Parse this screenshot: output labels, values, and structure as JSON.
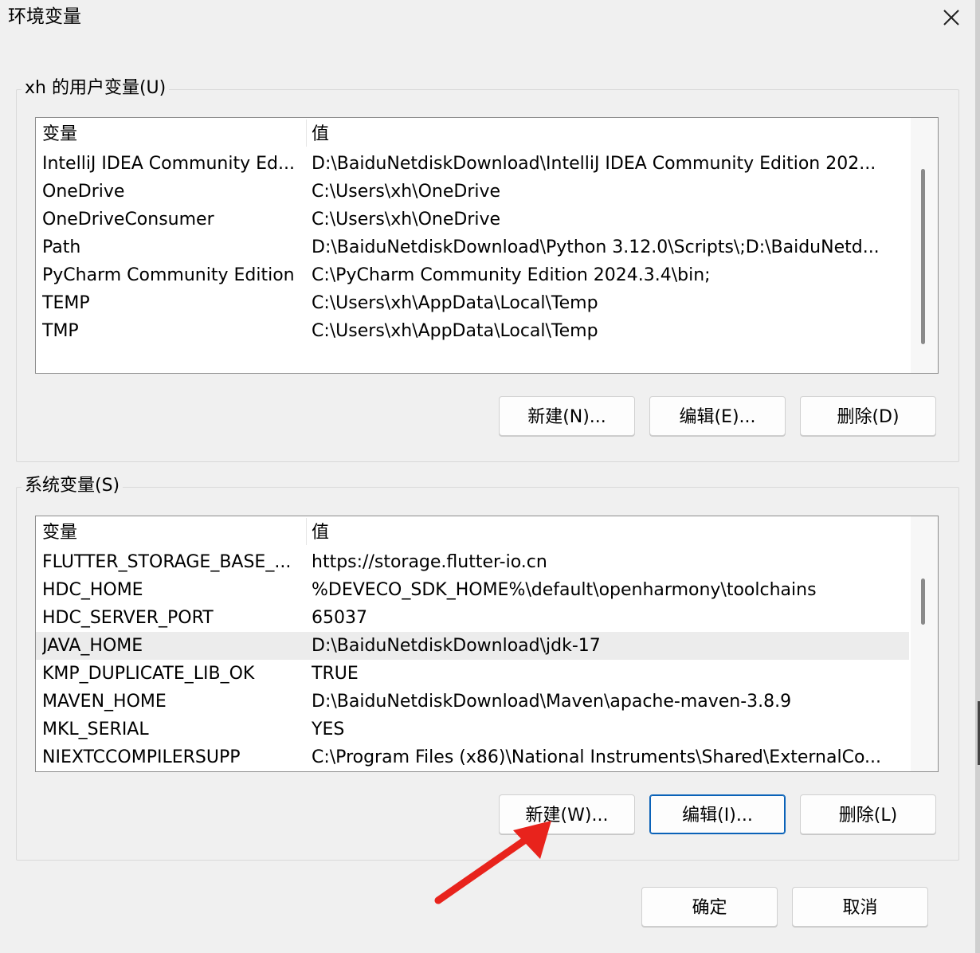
{
  "window": {
    "title": "环境变量",
    "close_icon": "close-icon"
  },
  "user_vars": {
    "group_label": "xh 的用户变量(U)",
    "columns": [
      "变量",
      "值"
    ],
    "rows": [
      {
        "name": "IntelliJ IDEA Community Ed...",
        "value": "D:\\BaiduNetdiskDownload\\IntelliJ IDEA Community Edition 202..."
      },
      {
        "name": "OneDrive",
        "value": "C:\\Users\\xh\\OneDrive"
      },
      {
        "name": "OneDriveConsumer",
        "value": "C:\\Users\\xh\\OneDrive"
      },
      {
        "name": "Path",
        "value": "D:\\BaiduNetdiskDownload\\Python 3.12.0\\Scripts\\;D:\\BaiduNetd..."
      },
      {
        "name": "PyCharm Community Edition",
        "value": "C:\\PyCharm Community Edition 2024.3.4\\bin;"
      },
      {
        "name": "TEMP",
        "value": "C:\\Users\\xh\\AppData\\Local\\Temp"
      },
      {
        "name": "TMP",
        "value": "C:\\Users\\xh\\AppData\\Local\\Temp"
      }
    ],
    "buttons": {
      "new": "新建(N)...",
      "edit": "编辑(E)...",
      "delete": "删除(D)"
    }
  },
  "sys_vars": {
    "group_label": "系统变量(S)",
    "columns": [
      "变量",
      "值"
    ],
    "rows": [
      {
        "name": "FLUTTER_STORAGE_BASE_...",
        "value": "https://storage.flutter-io.cn"
      },
      {
        "name": "HDC_HOME",
        "value": "%DEVECO_SDK_HOME%\\default\\openharmony\\toolchains"
      },
      {
        "name": "HDC_SERVER_PORT",
        "value": "65037"
      },
      {
        "name": "JAVA_HOME",
        "value": "D:\\BaiduNetdiskDownload\\jdk-17",
        "selected": true
      },
      {
        "name": "KMP_DUPLICATE_LIB_OK",
        "value": "TRUE"
      },
      {
        "name": "MAVEN_HOME",
        "value": "D:\\BaiduNetdiskDownload\\Maven\\apache-maven-3.8.9"
      },
      {
        "name": "MKL_SERIAL",
        "value": "YES"
      },
      {
        "name": "NIEXTCCOMPILERSUPP",
        "value": "C:\\Program Files (x86)\\National Instruments\\Shared\\ExternalCo..."
      }
    ],
    "buttons": {
      "new": "新建(W)...",
      "edit": "编辑(I)...",
      "delete": "删除(L)"
    }
  },
  "footer": {
    "ok": "确定",
    "cancel": "取消"
  },
  "annotation": {
    "color": "#e8231c"
  }
}
